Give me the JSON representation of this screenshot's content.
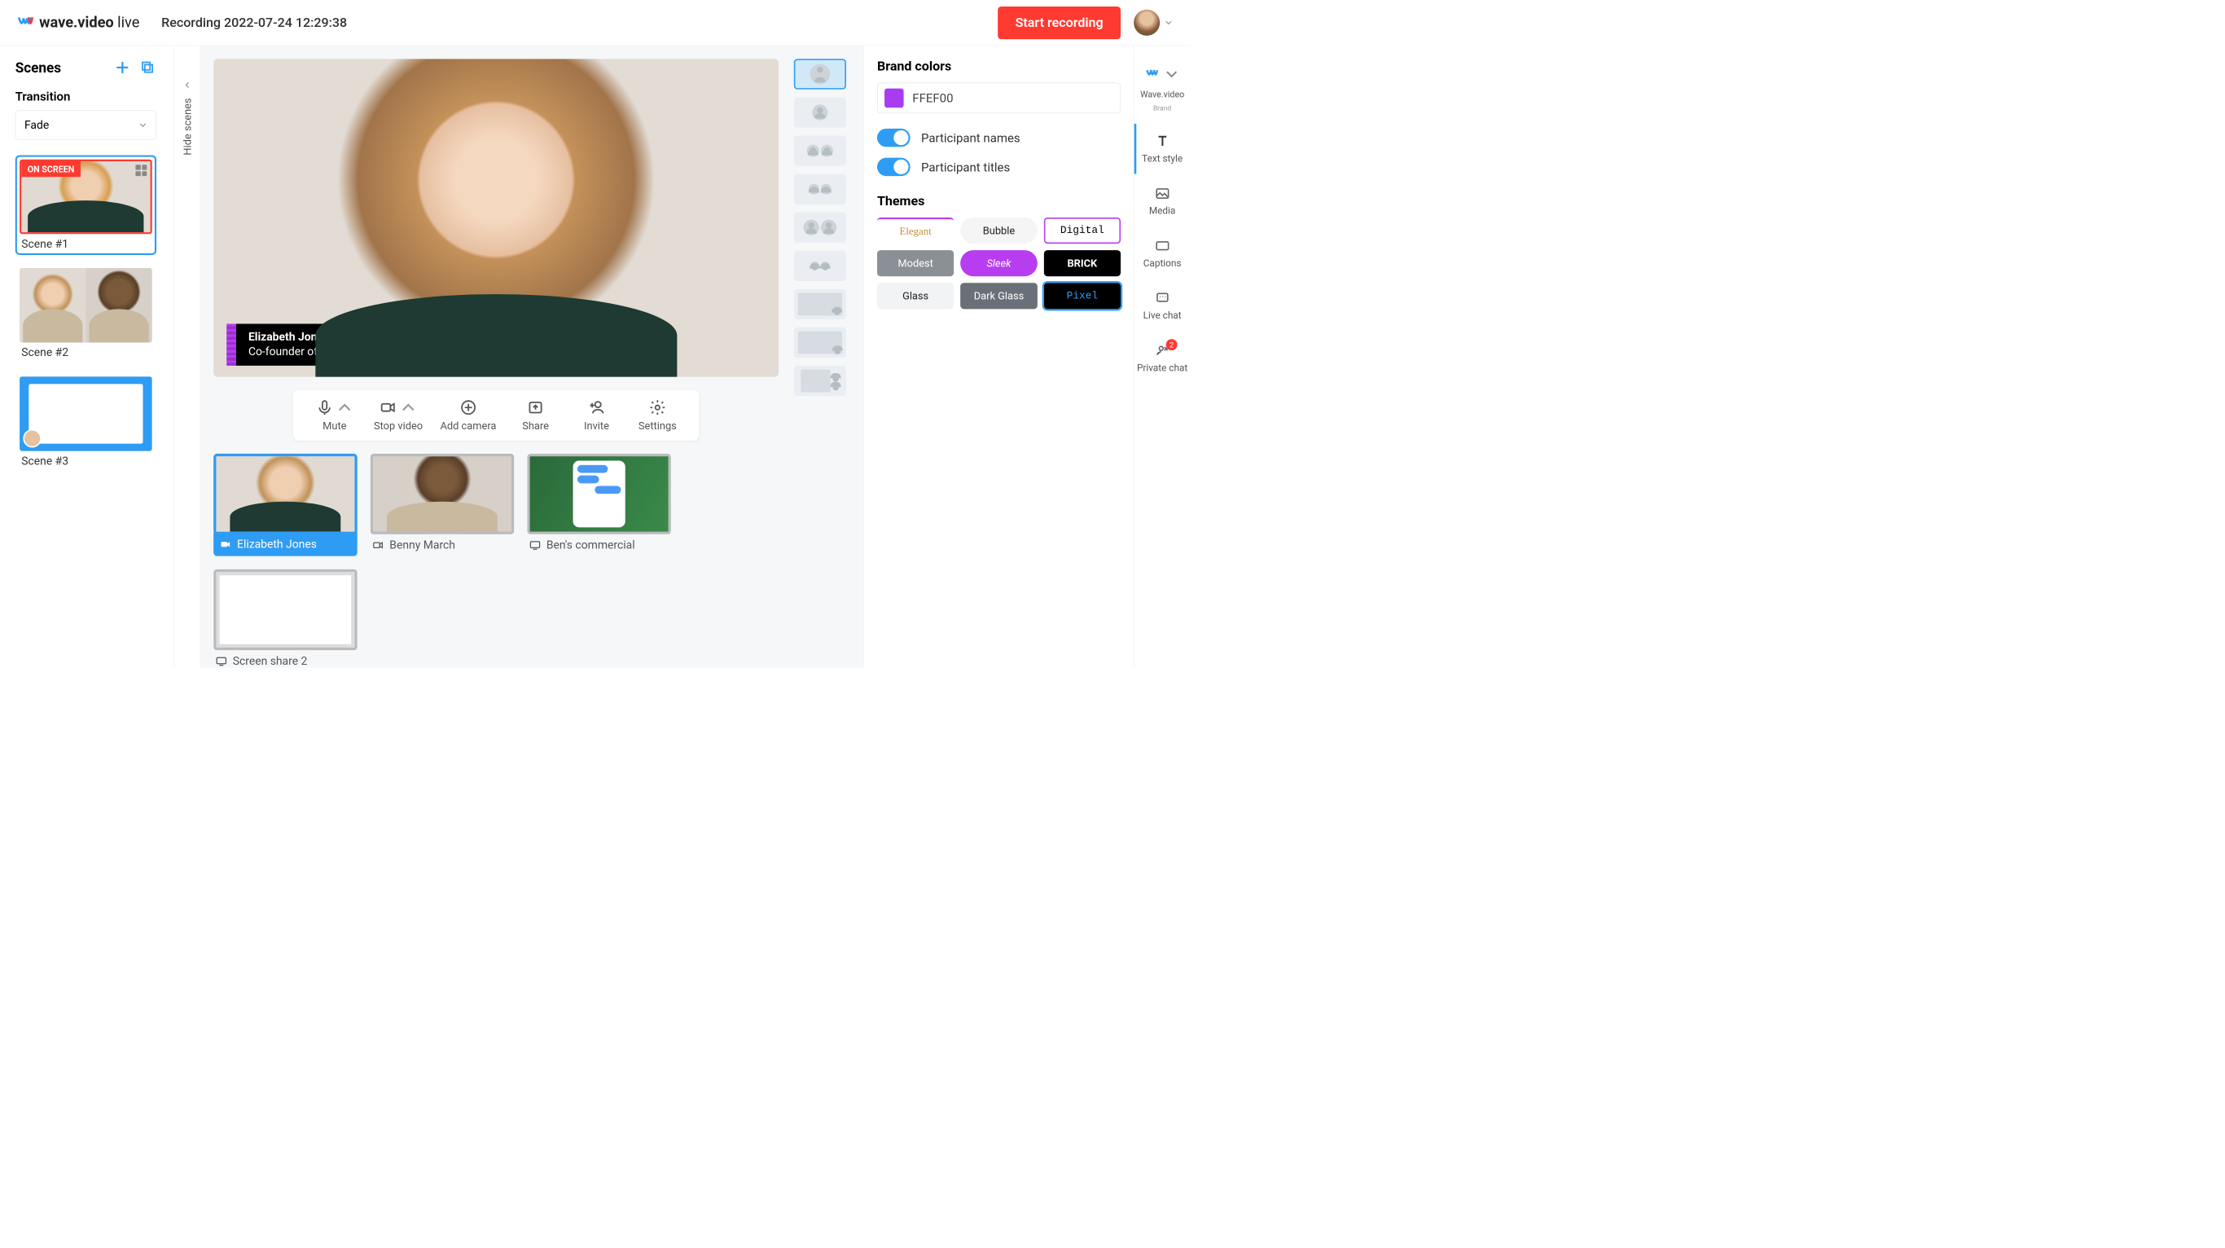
{
  "header": {
    "logo_name": "wave.video",
    "logo_suffix": "live",
    "recording_title": "Recording 2022-07-24 12:29:38",
    "start_button": "Start recording"
  },
  "left_panel": {
    "title": "Scenes",
    "transition_label": "Transition",
    "transition_selected": "Fade",
    "scenes": [
      {
        "label": "Scene #1",
        "badge": "ON SCREEN",
        "active": true
      },
      {
        "label": "Scene #2",
        "active": false
      },
      {
        "label": "Scene #3",
        "active": false
      }
    ]
  },
  "hide_scenes_label": "Hide scenes",
  "stage": {
    "lower_third": {
      "name": "Elizabeth Jones",
      "title": "Co-founder of Quick Solutions"
    },
    "controls": {
      "mute": "Mute",
      "stop_video": "Stop video",
      "add_camera": "Add camera",
      "share": "Share",
      "invite": "Invite",
      "settings": "Settings"
    }
  },
  "sources": [
    {
      "label": "Elizabeth Jones",
      "icon": "camera",
      "active": true
    },
    {
      "label": "Benny March",
      "icon": "camera",
      "active": false
    },
    {
      "label": "Ben's commercial",
      "icon": "screen",
      "active": false
    },
    {
      "label": "Screen share 2",
      "icon": "screen",
      "active": false
    }
  ],
  "right_panel": {
    "brand_colors_title": "Brand colors",
    "color_value": "FFEF00",
    "color_swatch": "#A93BF1",
    "toggle_names": "Participant names",
    "toggle_titles": "Participant titles",
    "themes_title": "Themes",
    "themes": [
      {
        "label": "Elegant",
        "bg": "#ffffff",
        "fg": "#c78c3a",
        "font": "serif",
        "accent": "#b83df0"
      },
      {
        "label": "Bubble",
        "bg": "#f5f5f5",
        "fg": "#222",
        "font": "sans",
        "pill": true
      },
      {
        "label": "Digital",
        "bg": "#ffffff",
        "fg": "#000",
        "font": "mono",
        "border": "#b83df0"
      },
      {
        "label": "Modest",
        "bg": "#8b9096",
        "fg": "#fff",
        "font": "sans"
      },
      {
        "label": "Sleek",
        "bg": "#b83df0",
        "fg": "#fff",
        "font": "italic",
        "pill": true
      },
      {
        "label": "BRICK",
        "bg": "#000",
        "fg": "#fff",
        "font": "sans",
        "bold": true
      },
      {
        "label": "Glass",
        "bg": "#f2f3f5",
        "fg": "#222",
        "font": "sans"
      },
      {
        "label": "Dark Glass",
        "bg": "#6a7077",
        "fg": "#fff",
        "font": "sans"
      },
      {
        "label": "Pixel",
        "bg": "#000",
        "fg": "#2f9cf4",
        "font": "mono",
        "selected": true
      }
    ]
  },
  "rail": {
    "brand_label": "Wave.video",
    "brand_sub": "Brand",
    "items": [
      {
        "label": "Text style",
        "active": true
      },
      {
        "label": "Media"
      },
      {
        "label": "Captions"
      },
      {
        "label": "Live chat"
      },
      {
        "label": "Private chat",
        "badge": "2"
      }
    ]
  }
}
